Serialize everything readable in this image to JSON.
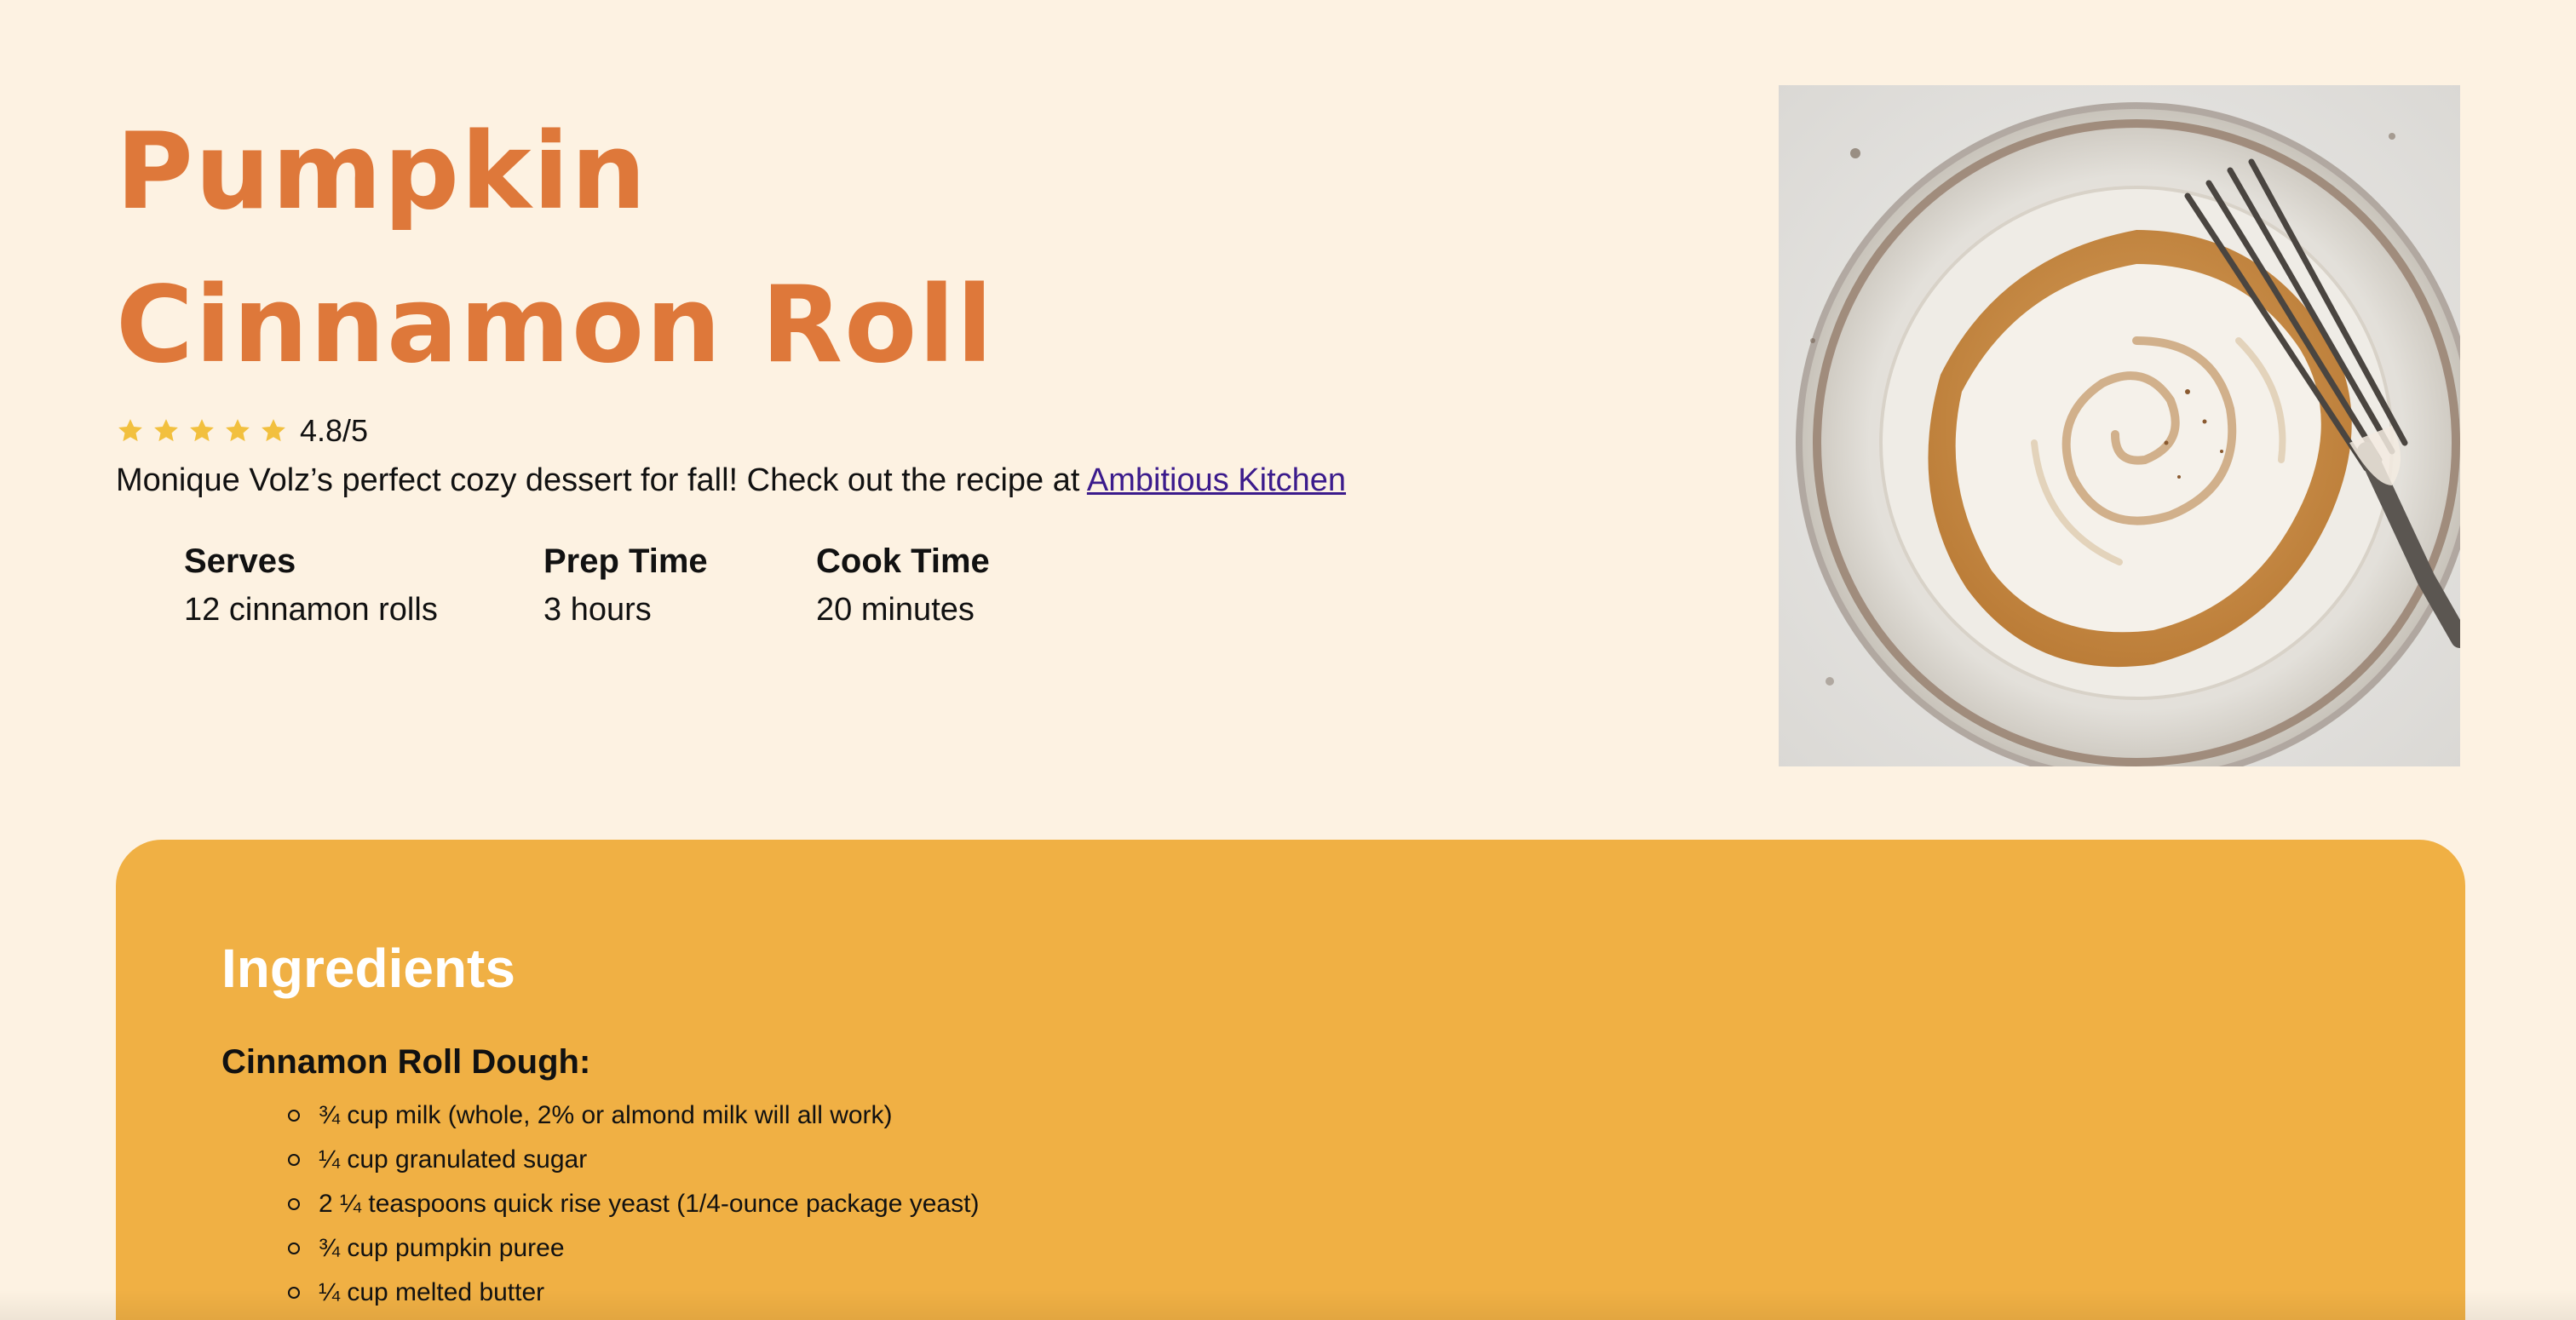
{
  "recipe": {
    "title_line1": "Pumpkin",
    "title_line2": "Cinnamon Roll",
    "rating": {
      "stars": 5,
      "text": "4.8/5",
      "star_color": "#f2c03e"
    },
    "description_text": "Monique Volz’s perfect cozy dessert for fall! Check out the recipe at ",
    "description_link": "Ambitious Kitchen",
    "stats": {
      "serves": {
        "label": "Serves",
        "value": "12 cinnamon rolls"
      },
      "prep": {
        "label": "Prep Time",
        "value": "3 hours"
      },
      "cook": {
        "label": "Cook Time",
        "value": "20 minutes"
      }
    },
    "photo_icon": "cinnamon-roll-photo"
  },
  "ingredients": {
    "heading": "Ingredients",
    "sections": [
      {
        "title": "Cinnamon Roll Dough:",
        "items": [
          "¾ cup milk (whole, 2% or almond milk will all work)",
          "¼ cup granulated sugar",
          "2 ¼ teaspoons quick rise yeast (1/4-ounce package yeast)",
          "¾ cup pumpkin puree",
          "¼ cup melted butter"
        ]
      }
    ]
  },
  "colors": {
    "background": "#fdf2e2",
    "title": "#de783a",
    "card": "#f0b044",
    "link": "#3b1b8c",
    "heading_on_card": "#ffffff"
  }
}
